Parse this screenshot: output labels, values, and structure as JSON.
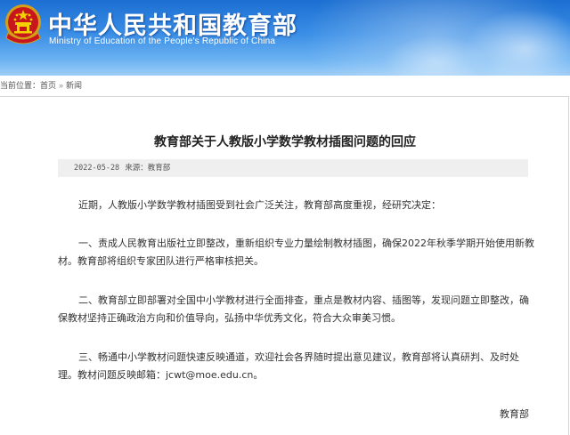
{
  "header": {
    "title_cn": "中华人民共和国教育部",
    "title_en": "Ministry of Education of the People's Republic of China",
    "colors": {
      "top": "#1c6fd1",
      "bottom": "#9dcdf7",
      "text": "#ffffff"
    }
  },
  "breadcrumb": {
    "label": "当前位置：",
    "items": [
      "首页",
      "新闻"
    ],
    "separator": "»"
  },
  "article": {
    "title": "教育部关于人教版小学数学教材插图问题的回应",
    "date": "2022-05-28",
    "source": "来源：教育部",
    "paragraphs": [
      "近期，人教版小学数学教材插图受到社会广泛关注，教育部高度重视，经研究决定：",
      "一、责成人民教育出版社立即整改，重新组织专业力量绘制教材插图，确保2022年秋季学期开始使用新教材。教育部将组织专家团队进行严格审核把关。",
      "二、教育部立即部署对全国中小学教材进行全面排查，重点是教材内容、插图等，发现问题立即整改，确保教材坚持正确政治方向和价值导向，弘扬中华优秀文化，符合大众审美习惯。",
      "三、畅通中小学教材问题快速反映通道，欢迎社会各界随时提出意见建议，教育部将认真研判、及时处理。教材问题反映邮箱：jcwt@moe.edu.cn。"
    ],
    "signature": "教育部"
  }
}
